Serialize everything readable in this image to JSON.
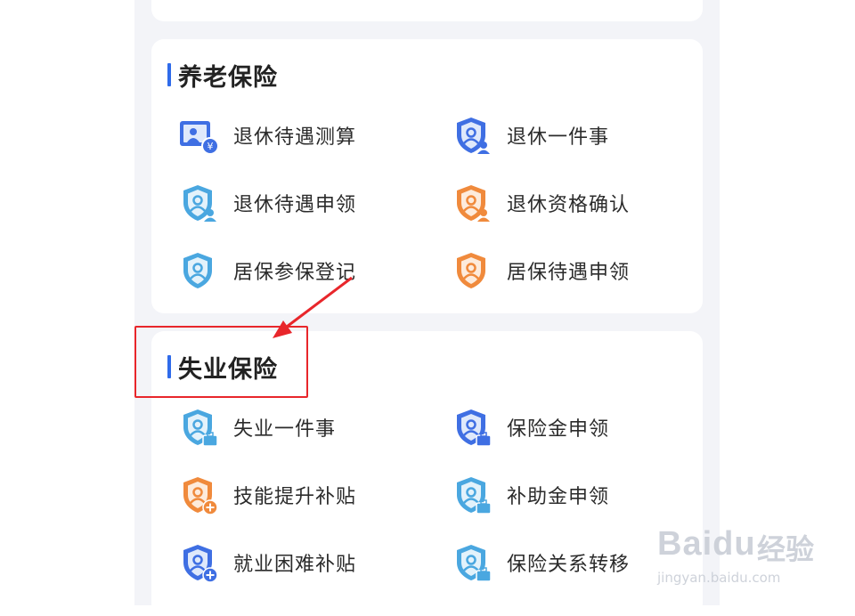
{
  "pension": {
    "title": "养老保险",
    "items": [
      {
        "label": "退休待遇测算",
        "icon": "calculator-yuan-icon"
      },
      {
        "label": "退休一件事",
        "icon": "shield-person-icon"
      },
      {
        "label": "退休待遇申领",
        "icon": "shield-person-icon"
      },
      {
        "label": "退休资格确认",
        "icon": "shield-person-icon"
      },
      {
        "label": "居保参保登记",
        "icon": "shield-person-icon"
      },
      {
        "label": "居保待遇申领",
        "icon": "shield-person-icon"
      }
    ]
  },
  "unemployment": {
    "title": "失业保险",
    "items": [
      {
        "label": "失业一件事",
        "icon": "shield-briefcase-icon"
      },
      {
        "label": "保险金申领",
        "icon": "shield-briefcase-icon"
      },
      {
        "label": "技能提升补贴",
        "icon": "shield-plus-icon"
      },
      {
        "label": "补助金申领",
        "icon": "shield-briefcase-icon"
      },
      {
        "label": "就业困难补贴",
        "icon": "shield-plus-icon"
      },
      {
        "label": "保险关系转移",
        "icon": "shield-briefcase-icon"
      }
    ]
  },
  "watermark": {
    "logo": "Baidu",
    "suffix": "经验",
    "url": "jingyan.baidu.com"
  },
  "colors": {
    "accent": "#2f6bea",
    "blue": "#3f6fe3",
    "cyan": "#4aa7e0",
    "orange": "#f08a3c",
    "annotation": "#e8262b"
  }
}
